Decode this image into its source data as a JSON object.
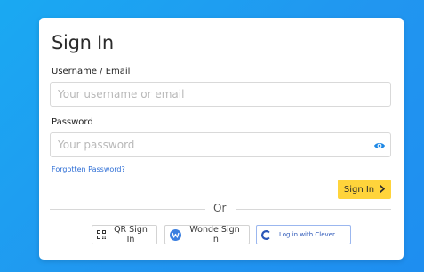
{
  "title": "Sign In",
  "username": {
    "label": "Username / Email",
    "placeholder": "Your username or email",
    "value": ""
  },
  "password": {
    "label": "Password",
    "placeholder": "Your password",
    "value": ""
  },
  "forgot_link": "Forgotten Password?",
  "signin_button": "Sign In",
  "divider_text": "Or",
  "alt_buttons": {
    "qr": "QR Sign In",
    "wonde": "Wonde Sign In",
    "clever": "Log in with Clever"
  },
  "colors": {
    "background": "#1e9cf0",
    "signin_button": "#ffd43b",
    "link": "#2f6fd6",
    "eye_icon": "#1e88e5",
    "wonde": "#3b7fe0",
    "clever": "#2a56b8"
  },
  "icons": {
    "eye": "eye-icon",
    "chevron": "chevron-right-icon",
    "qr": "qr-code-icon",
    "wonde": "wonde-logo-icon",
    "clever": "clever-logo-icon"
  }
}
